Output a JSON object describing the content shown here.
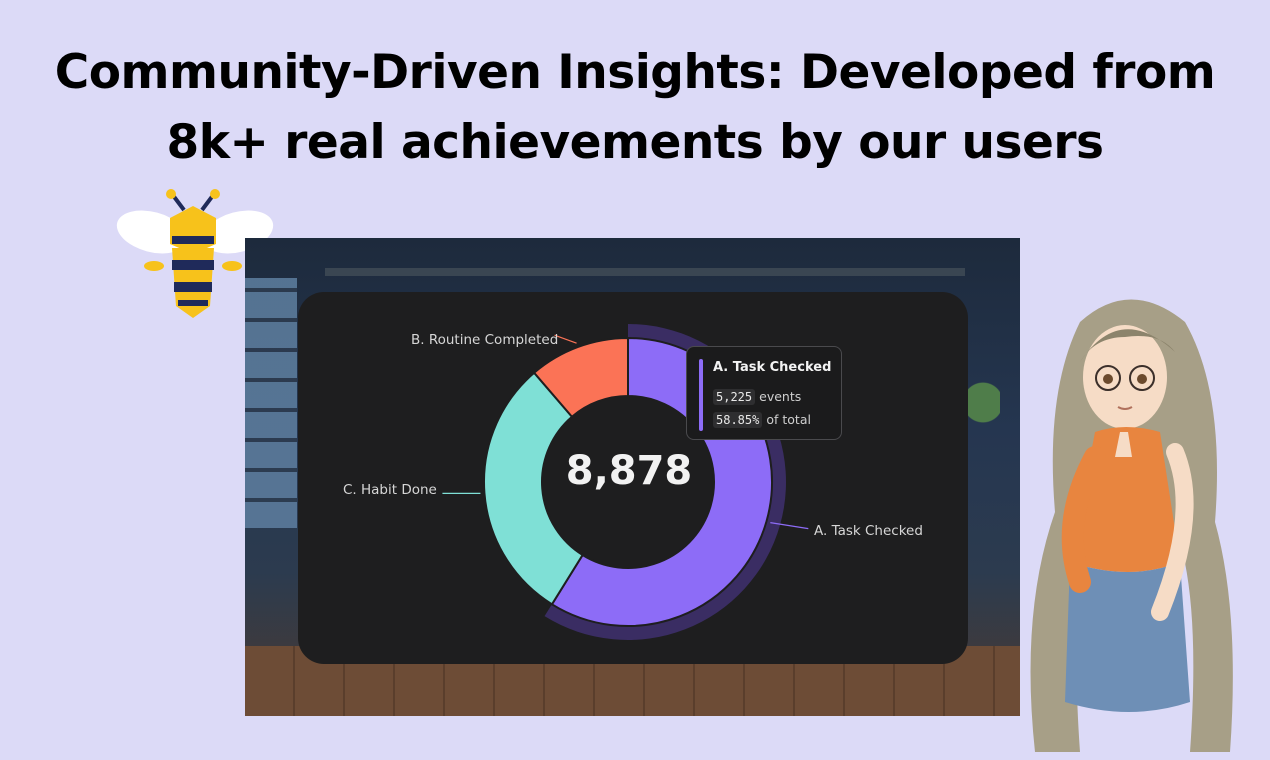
{
  "headline": {
    "line1": "Community-Driven Insights: Developed from",
    "line2": "8k+ real achievements by our users"
  },
  "chart_data": {
    "type": "pie",
    "donut": true,
    "center_total": "8,878",
    "slices": [
      {
        "name": "A. Task Checked",
        "value": 5225,
        "percent": 58.85,
        "color": "#8d6cf7",
        "label_side": "right"
      },
      {
        "name": "C. Habit Done",
        "value": 2650,
        "percent": 29.85,
        "color": "#7fe0d6",
        "label_side": "left"
      },
      {
        "name": "B. Routine Completed",
        "value": 1003,
        "percent": 11.3,
        "color": "#fb7356",
        "label_side": "top-left"
      }
    ],
    "highlighted": "A. Task Checked",
    "highlight_color": "#3a2d63",
    "tooltip": {
      "title": "A. Task Checked",
      "count": "5,225",
      "count_unit": "events",
      "share": "58.85%",
      "share_unit": "of total"
    }
  },
  "icons": {
    "bee": "bee-mascot-icon",
    "character": "anime-girl-illustration"
  }
}
